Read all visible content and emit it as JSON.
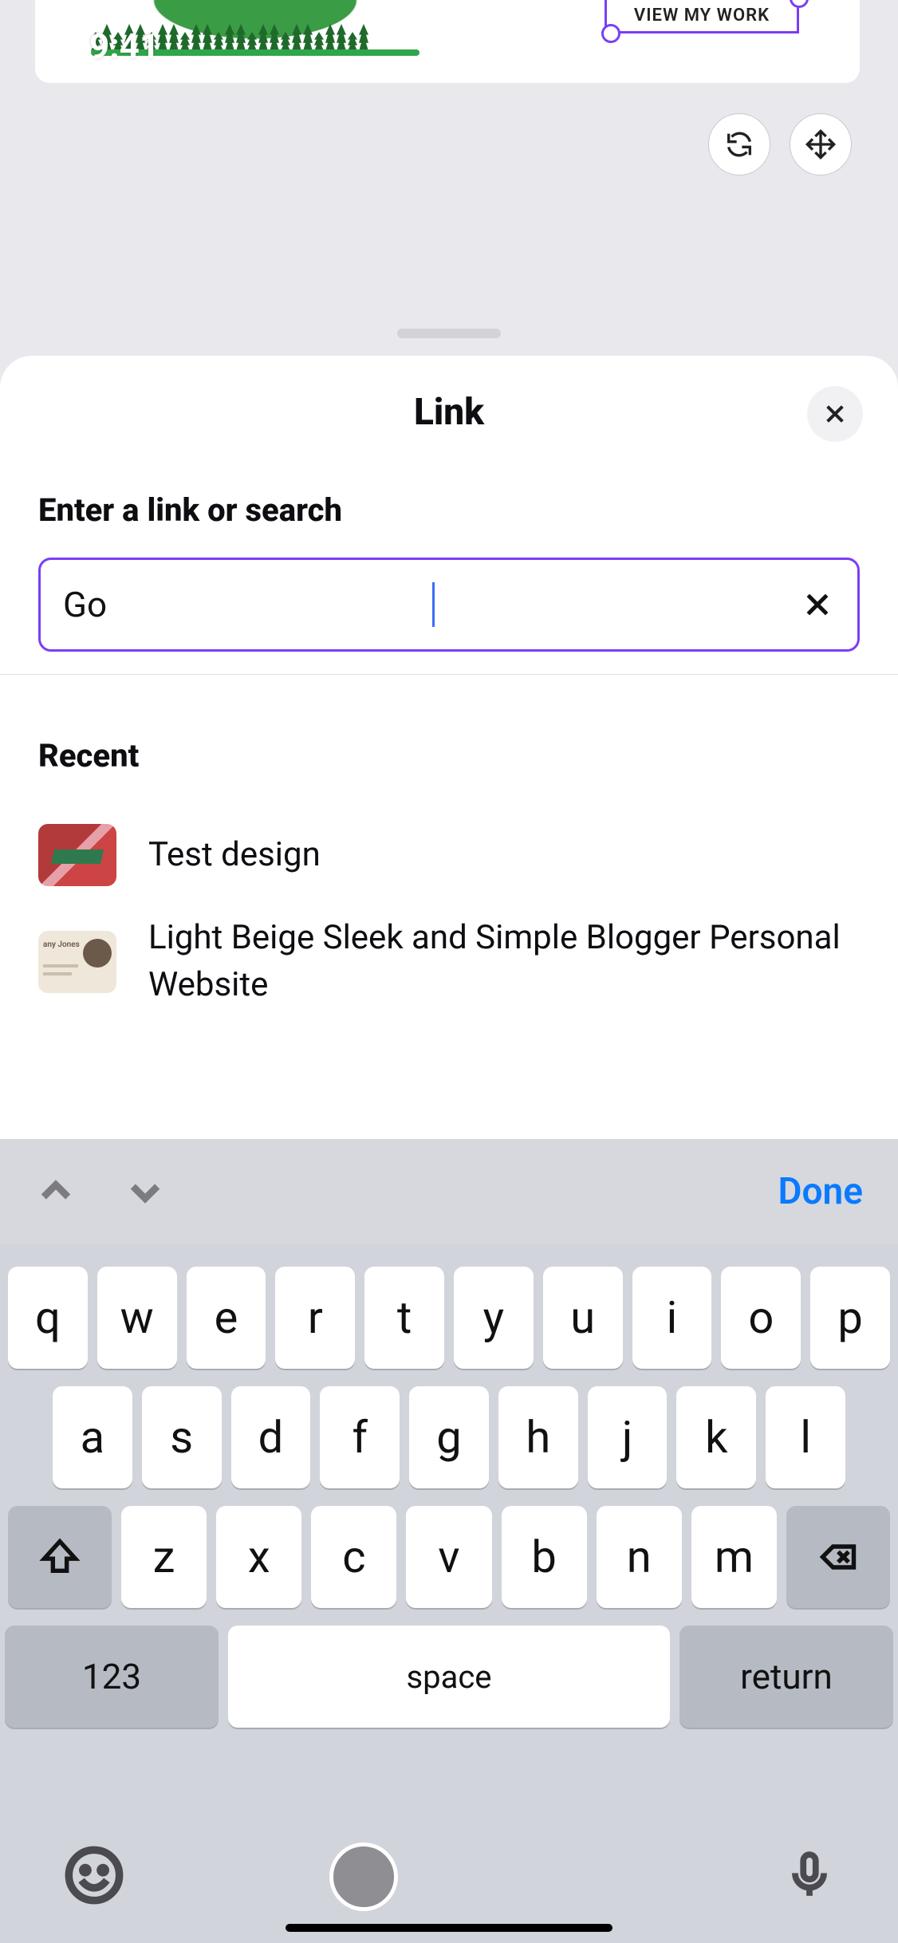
{
  "status": {
    "time": "9:41"
  },
  "canvas": {
    "cta_label": "VIEW MY WORK",
    "float_buttons": {
      "sync": "sync-icon",
      "move": "move-icon"
    }
  },
  "sheet": {
    "title": "Link",
    "close": "×",
    "field_label": "Enter a link or search",
    "input_value": "Go",
    "recent_heading": "Recent",
    "recent": [
      {
        "title": "Test design"
      },
      {
        "title": "Light Beige Sleek and Simple Blogger Personal Website"
      }
    ]
  },
  "keyboard": {
    "arrows": {
      "up": "chevron-up",
      "down": "chevron-down"
    },
    "done_label": "Done",
    "rows": {
      "r1": [
        "q",
        "w",
        "e",
        "r",
        "t",
        "y",
        "u",
        "i",
        "o",
        "p"
      ],
      "r2": [
        "a",
        "s",
        "d",
        "f",
        "g",
        "h",
        "j",
        "k",
        "l"
      ],
      "r3": [
        "z",
        "x",
        "c",
        "v",
        "b",
        "n",
        "m"
      ]
    },
    "bottom": {
      "numbers": "123",
      "space": "space",
      "return": "return"
    },
    "thumb2_name": "any Jones"
  }
}
